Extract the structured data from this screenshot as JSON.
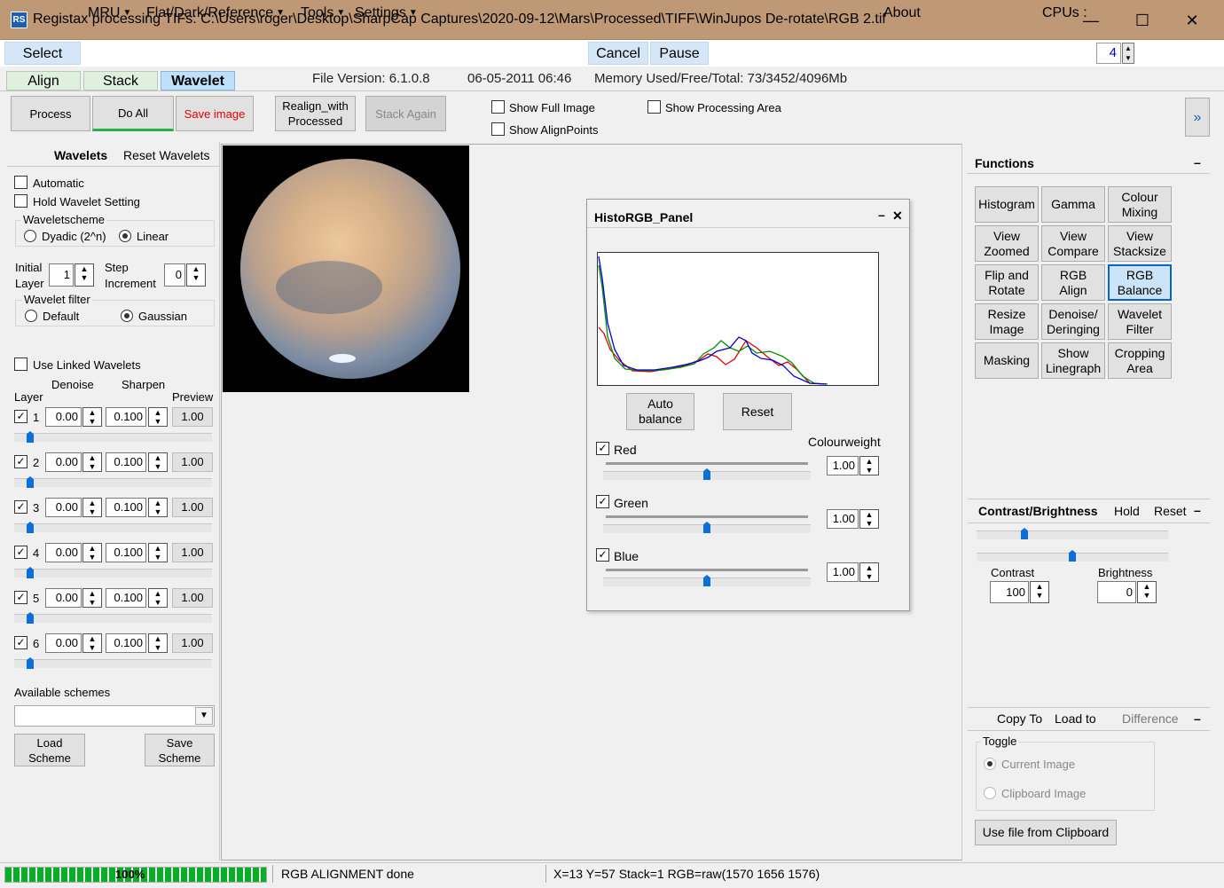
{
  "window": {
    "title": "Registax processing TIFs: C:\\Users\\roger\\Desktop\\SharpCap Captures\\2020-09-12\\Mars\\Processed\\TIFF\\WinJupos De-rotate\\RGB 2.tif",
    "icon": "RS",
    "minimize": "—",
    "maximize": "☐",
    "close": "✕"
  },
  "menu": {
    "select": "Select",
    "mru": "MRU",
    "flat": "Flat/Dark/Reference",
    "tools": "Tools",
    "settings": "Settings",
    "cancel": "Cancel",
    "pause": "Pause",
    "about": "About",
    "cpus_label": "CPUs :",
    "cpus_value": "4"
  },
  "tabs": {
    "align": "Align",
    "stack": "Stack",
    "wavelet": "Wavelet",
    "file_version": "File Version: 6.1.0.8",
    "date": "06-05-2011 06:46",
    "memory": "Memory Used/Free/Total: 73/3452/4096Mb"
  },
  "toolbar": {
    "process": "Process",
    "do_all": "Do All",
    "save_image": "Save image",
    "realign_1": "Realign_with",
    "realign_2": "Processed",
    "stack_again": "Stack Again",
    "show_full": "Show Full Image",
    "show_align": "Show AlignPoints",
    "show_area": "Show Processing Area",
    "expand": "»"
  },
  "wavelets": {
    "title": "Wavelets",
    "reset": "Reset Wavelets",
    "automatic": "Automatic",
    "hold": "Hold Wavelet Setting",
    "scheme_label": "Waveletscheme",
    "dyadic": "Dyadic (2^n)",
    "linear": "Linear",
    "initial": "Initial",
    "layer": "Layer",
    "initial_val": "1",
    "step": "Step",
    "increment": "Increment",
    "step_val": "0",
    "filter_label": "Wavelet filter",
    "default": "Default",
    "gaussian": "Gaussian",
    "use_linked": "Use Linked Wavelets",
    "col_layer": "Layer",
    "col_denoise": "Denoise",
    "col_sharpen": "Sharpen",
    "col_preview": "Preview",
    "layers": [
      {
        "n": "1",
        "denoise": "0.00",
        "sharpen": "0.100",
        "preview": "1.00",
        "checked": true,
        "level": 0.08
      },
      {
        "n": "2",
        "denoise": "0.00",
        "sharpen": "0.100",
        "preview": "1.00",
        "checked": true,
        "level": 0.08
      },
      {
        "n": "3",
        "denoise": "0.00",
        "sharpen": "0.100",
        "preview": "1.00",
        "checked": true,
        "level": 0.08
      },
      {
        "n": "4",
        "denoise": "0.00",
        "sharpen": "0.100",
        "preview": "1.00",
        "checked": true,
        "level": 0.08
      },
      {
        "n": "5",
        "denoise": "0.00",
        "sharpen": "0.100",
        "preview": "1.00",
        "checked": true,
        "level": 0.08
      },
      {
        "n": "6",
        "denoise": "0.00",
        "sharpen": "0.100",
        "preview": "1.00",
        "checked": true,
        "level": 0.08
      }
    ],
    "available": "Available schemes",
    "load_1": "Load",
    "load_2": "Scheme",
    "save_1": "Save",
    "save_2": "Scheme"
  },
  "histo": {
    "title": "HistoRGB_Panel",
    "min": "–",
    "close": "✕",
    "auto_1": "Auto",
    "auto_2": "balance",
    "reset": "Reset",
    "colourweight": "Colourweight",
    "channels": [
      {
        "name": "Red",
        "value": "1.00",
        "level": 0.5
      },
      {
        "name": "Green",
        "value": "1.00",
        "level": 0.5
      },
      {
        "name": "Blue",
        "value": "1.00",
        "level": 0.5
      }
    ],
    "colors": {
      "red": "#e00000",
      "green": "#009000",
      "blue": "#0000d0"
    }
  },
  "functions": {
    "title": "Functions",
    "collapse": "–",
    "buttons": [
      [
        "Histogram",
        ""
      ],
      [
        "Gamma",
        ""
      ],
      [
        "Colour",
        "Mixing"
      ],
      [
        "View",
        "Zoomed"
      ],
      [
        "View",
        "Compare"
      ],
      [
        "View",
        "Stacksize"
      ],
      [
        "Flip and",
        "Rotate"
      ],
      [
        "RGB",
        "Align"
      ],
      [
        "RGB",
        "Balance"
      ],
      [
        "Resize",
        "Image"
      ],
      [
        "Denoise/",
        "Deringing"
      ],
      [
        "Wavelet",
        "Filter"
      ],
      [
        "Masking",
        ""
      ],
      [
        "Show",
        "Linegraph"
      ],
      [
        "Cropping",
        "Area"
      ]
    ]
  },
  "contrast": {
    "title": "Contrast/Brightness",
    "hold": "Hold",
    "reset": "Reset",
    "collapse": "–",
    "contrast_label": "Contrast",
    "contrast_val": "100",
    "brightness_label": "Brightness",
    "brightness_val": "0",
    "slider1_level": 0.25,
    "slider2_level": 0.5
  },
  "copy": {
    "copy_to": "Copy To",
    "load_to": "Load to",
    "difference": "Difference",
    "collapse": "–",
    "toggle": "Toggle",
    "current": "Current Image",
    "clipboard": "Clipboard Image",
    "use_clip": "Use file from Clipboard"
  },
  "status": {
    "progress": "100%",
    "progress_level": 1.0,
    "message": "RGB ALIGNMENT done",
    "coords": "X=13 Y=57 Stack=1 RGB=raw(1570 1656 1576)"
  }
}
